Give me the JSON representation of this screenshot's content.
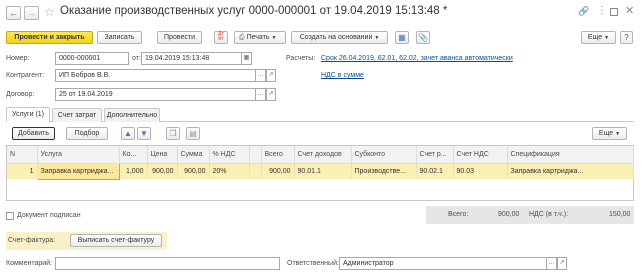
{
  "window": {
    "title": "Оказание производственных услуг 0000-000001 от 19.04.2019 15:13:48 *",
    "back_icon": "arrow-left",
    "forward_icon": "arrow-right",
    "star_icon": "star-outline",
    "link_icon": "chain-link",
    "more_icon": "vertical-dots",
    "maximize_icon": "square",
    "close_icon": "x"
  },
  "toolbar": {
    "post_close": "Провести и закрыть",
    "write": "Записать",
    "post": "Провести",
    "print": "Печать",
    "create_based": "Создать на основании",
    "more": "Еще"
  },
  "header": {
    "number_label": "Номер:",
    "number_value": "0000-000001",
    "date_from_label": "от:",
    "date_value": "19.04.2019 15:13:48",
    "settlements_label": "Расчеты:",
    "settlements_link": "Срок 26.04.2019, 62.01, 62.02, зачет аванса автоматически",
    "counterparty_label": "Контрагент:",
    "counterparty_value": "ИП Бобров В.В.",
    "vat_link": "НДС в сумме",
    "contract_label": "Договор:",
    "contract_value": "25 от 19.04.2019"
  },
  "tabs": [
    {
      "label": "Услуги (1)",
      "active": true
    },
    {
      "label": "Счет затрат",
      "active": false
    },
    {
      "label": "Дополнительно",
      "active": false
    }
  ],
  "table_toolbar": {
    "add": "Добавить",
    "pick": "Подбор",
    "more": "Еще"
  },
  "table": {
    "headers": [
      "N",
      "Услуга",
      "Ко...",
      "Цена",
      "Сумма",
      "% НДС",
      "",
      "Всего",
      "Счет доходов",
      "Субконто",
      "Счет р...",
      "Счет НДС",
      "Спецификация"
    ],
    "rows": [
      [
        "1",
        "Заправка картриджа...",
        "1,000",
        "900,00",
        "900,00",
        "20%",
        "",
        "900,00",
        "90.01.1",
        "Производстве...",
        "90.02.1",
        "90.03",
        "Заправка картриджа..."
      ]
    ]
  },
  "footer": {
    "signed_label": "Документ подписан",
    "total_label": "Всего:",
    "total_value": "900,00",
    "vat_label": "НДС (в т.ч.):",
    "vat_value": "150,00",
    "invoice_label": "Счет-фактура:",
    "invoice_button": "Выписать счет-фактуру",
    "comment_label": "Комментарий:",
    "comment_value": "",
    "responsible_label": "Ответственный:",
    "responsible_value": "Администратор"
  },
  "colors": {
    "primary_button": "#f5d215",
    "selected_row": "#fbf0b4",
    "link": "#0b4e96",
    "invoice_panel": "#fbf0c8",
    "totals_panel": "#e6e6e6"
  }
}
